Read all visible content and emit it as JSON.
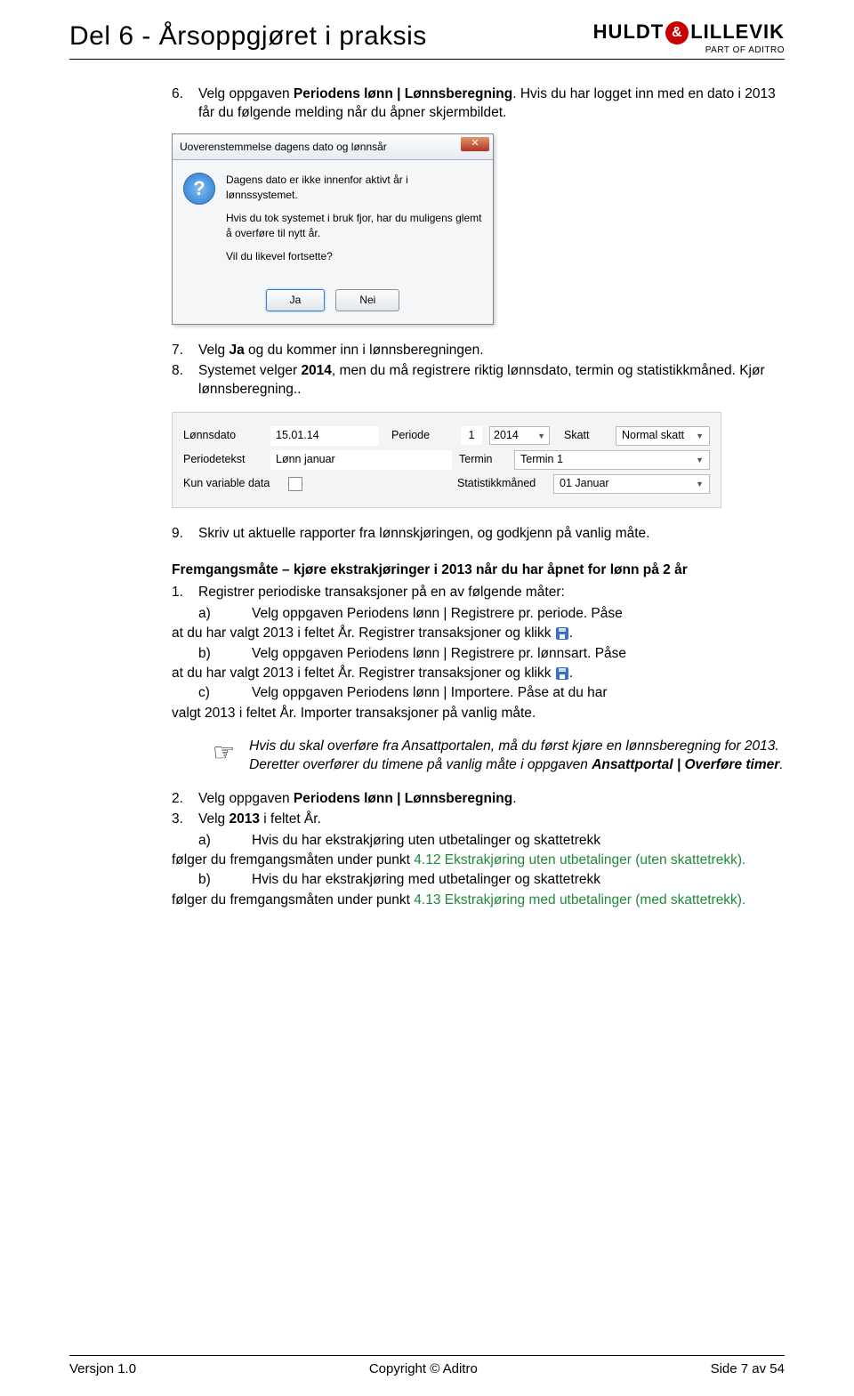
{
  "header": {
    "title": "Del 6 - Årsoppgjøret i praksis",
    "brand_left": "HULDT",
    "brand_amp": "&",
    "brand_right": "LILLEVIK",
    "brand_sub": "PART OF ADITRO"
  },
  "step6": {
    "num": "6.",
    "text_a": "Velg oppgaven ",
    "bold": "Periodens lønn | Lønnsberegning",
    "text_b": ". Hvis du har logget inn med en dato i 2013 får du følgende melding når du åpner skjermbildet."
  },
  "dialog": {
    "title": "Uoverenstemmelse dagens dato og lønnsår",
    "p1": "Dagens dato er ikke innenfor aktivt år i lønnssystemet.",
    "p2": "Hvis du tok systemet i bruk fjor, har du muligens glemt å overføre til nytt år.",
    "p3": "Vil du likevel fortsette?",
    "btn_ja": "Ja",
    "btn_nei": "Nei",
    "close": "✕"
  },
  "step7": {
    "num": "7.",
    "text_a": "Velg ",
    "bold": "Ja",
    "text_b": " og du kommer inn i lønnsberegningen."
  },
  "step8": {
    "num": "8.",
    "text_a": "Systemet velger ",
    "bold": "2014",
    "text_b": ", men du må registrere riktig lønnsdato, termin og statistikkmåned. Kjør lønnsberegning.."
  },
  "form": {
    "lbl_lonnsdato": "Lønnsdato",
    "val_lonnsdato": "15.01.14",
    "lbl_periode": "Periode",
    "val_periode_num": "1",
    "val_periode_year": "2014",
    "lbl_skatt": "Skatt",
    "val_skatt": "Normal skatt",
    "lbl_periodetekst": "Periodetekst",
    "val_periodetekst": "Lønn januar",
    "lbl_termin": "Termin",
    "val_termin": "Termin 1",
    "lbl_kunvar": "Kun variable data",
    "lbl_statmnd": "Statistikkmåned",
    "val_statmnd": "01 Januar"
  },
  "step9": {
    "num": "9.",
    "text": "Skriv ut aktuelle rapporter fra lønnskjøringen, og godkjenn på vanlig måte."
  },
  "section_heading": "Fremgangsmåte – kjøre ekstrakjøringer i 2013 når du har åpnet for lønn på 2 år",
  "s1": {
    "num": "1.",
    "text": "Registrer periodiske transaksjoner på en av følgende måter:"
  },
  "s1a": {
    "al": "a)",
    "t1": "Velg oppgaven Periodens lønn | Registrere pr. periode. Påse"
  },
  "s1a_cont": "at du har valgt 2013 i feltet År. Registrer transaksjoner og klikk",
  "s1a_end": ".",
  "s1b": {
    "al": "b)",
    "t1": "Velg oppgaven Periodens lønn | Registrere pr. lønnsart. Påse"
  },
  "s1b_cont": "at du har valgt 2013 i feltet År. Registrer transaksjoner og klikk",
  "s1b_end": ".",
  "s1c": {
    "al": "c)",
    "t1": "Velg oppgaven Periodens lønn | Importere. Påse at du har"
  },
  "s1c_cont": "valgt 2013 i feltet År. Importer transaksjoner på vanlig måte.",
  "note": {
    "l1": "Hvis du skal overføre fra Ansattportalen, må du først kjøre en lønnsberegning for 2013. Deretter overfører du timene på vanlig måte i oppgaven ",
    "bold": "Ansattportal | Overføre timer",
    "end": "."
  },
  "s2": {
    "num": "2.",
    "t1": "Velg oppgaven ",
    "bold": "Periodens lønn | Lønnsberegning",
    "end": "."
  },
  "s3": {
    "num": "3.",
    "t1": "Velg ",
    "bold": "2013",
    "t2": " i feltet År."
  },
  "s3a": {
    "al": "a)",
    "t1": "Hvis du har ekstrakjøring uten utbetalinger og skattetrekk"
  },
  "s3a_cont1": "følger du fremgangsmåten under punkt ",
  "s3a_link": "4.12  Ekstrakjøring uten utbetalinger (uten skattetrekk).",
  "s3b": {
    "al": "b)",
    "t1": "Hvis du har ekstrakjøring med utbetalinger og skattetrekk"
  },
  "s3b_cont1": "følger du fremgangsmåten under punkt ",
  "s3b_link": "4.13  Ekstrakjøring med utbetalinger (med skattetrekk).",
  "footer": {
    "left": "Versjon 1.0",
    "center": "Copyright © Aditro",
    "right": "Side 7 av 54"
  }
}
